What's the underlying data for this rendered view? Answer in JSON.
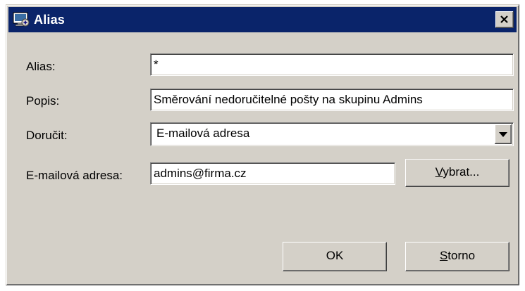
{
  "window": {
    "title": "Alias",
    "close_glyph": "✕",
    "icon": "alias-app-icon"
  },
  "form": {
    "alias_label": "Alias:",
    "alias_value": "*",
    "popis_label": "Popis:",
    "popis_value": "Směrování nedoručitelné pošty na skupinu Admins",
    "dorucit_label": "Doručit:",
    "dorucit_value": "E-mailová adresa",
    "email_label": "E-mailová adresa:",
    "email_value": "admins@firma.cz"
  },
  "buttons": {
    "vybrat_mnemonic": "V",
    "vybrat_rest": "ybrat...",
    "ok_label": "OK",
    "storno_mnemonic": "S",
    "storno_rest": "torno"
  },
  "colors": {
    "titlebar": "#0a246a",
    "face": "#d4d0c8",
    "field": "#ffffff"
  }
}
